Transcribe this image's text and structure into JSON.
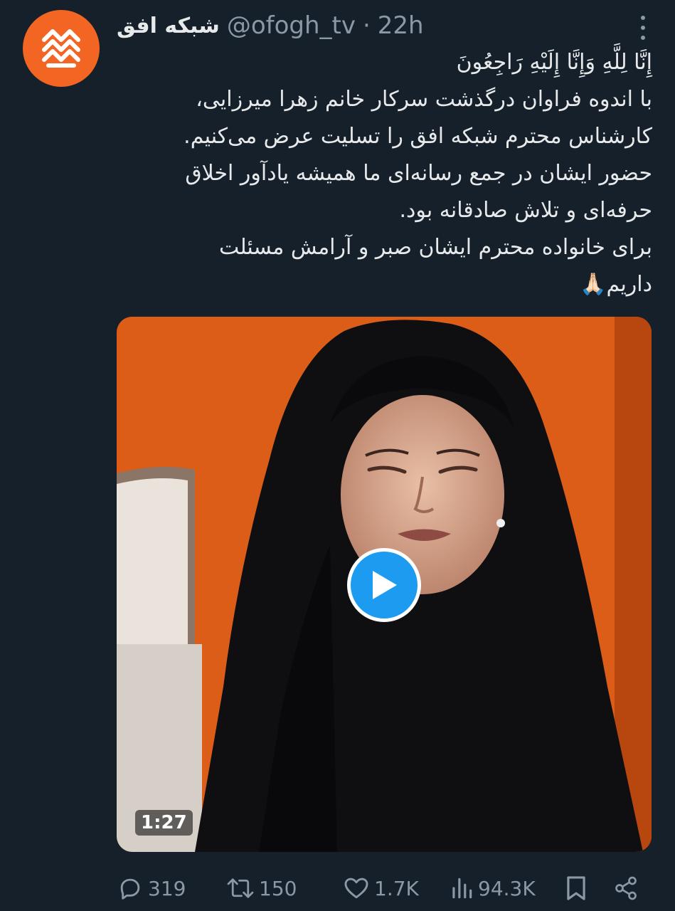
{
  "tweet": {
    "display_name": "شبکه افق",
    "handle": "@ofogh_tv",
    "separator": "·",
    "time": "22h",
    "avatar_icon": "ofogh-logo-icon",
    "text_lines": [
      "إِنَّا لِلَّهِ وَإِنَّا إِلَيْهِ رَاجِعُونَ",
      "با اندوه فراوان درگذشت سرکار خانم زهرا میرزایی،",
      "کارشناس محترم شبکه افق را تسلیت عرض می‌کنیم.",
      "حضور ایشان در جمع رسانه‌ای ما همیشه یادآور اخلاق",
      "حرفه‌ای و تلاش صادقانه بود.",
      "برای خانواده محترم ایشان صبر و آرامش مسئلت",
      "داریم🙏🏻"
    ]
  },
  "media": {
    "duration": "1:27",
    "play_icon": "play-icon"
  },
  "actions": {
    "replies": "319",
    "retweets": "150",
    "likes": "1.7K",
    "views": "94.3K"
  },
  "colors": {
    "background": "#15202b",
    "text": "#e7e9ea",
    "muted": "#8b98a5",
    "accent": "#1d9bf0",
    "brand_orange": "#f26522"
  }
}
